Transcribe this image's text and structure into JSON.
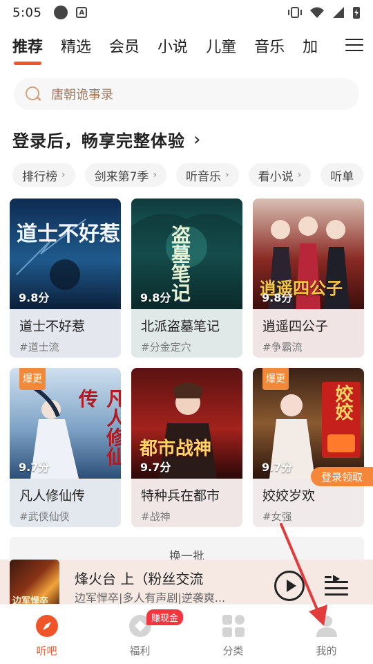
{
  "status_bar": {
    "time": "5:05",
    "notif_letter": "A"
  },
  "tabs": [
    {
      "label": "推荐"
    },
    {
      "label": "精选"
    },
    {
      "label": "会员"
    },
    {
      "label": "小说"
    },
    {
      "label": "儿童"
    },
    {
      "label": "音乐"
    },
    {
      "label": "加"
    }
  ],
  "search": {
    "placeholder": "唐朝诡事录"
  },
  "login_prompt": {
    "text": "登录后，畅享完整体验",
    "chevron": "›"
  },
  "chips": [
    {
      "label": "排行榜"
    },
    {
      "label": "剑来第7季"
    },
    {
      "label": "听音乐"
    },
    {
      "label": "看小说"
    },
    {
      "label": "听单"
    }
  ],
  "books": [
    {
      "title": "道士不好惹",
      "tag": "#道士流",
      "score": "9.8分",
      "cover_text": "道士不好惹",
      "hot": ""
    },
    {
      "title": "北派盗墓笔记",
      "tag": "#分金定穴",
      "score": "9.8分",
      "cover_text": "盗墓笔记",
      "hot": ""
    },
    {
      "title": "逍遥四公子",
      "tag": "#争霸流",
      "score": "9.8分",
      "cover_text": "逍遥四公子",
      "hot": ""
    },
    {
      "title": "凡人修仙传",
      "tag": "#武侠仙侠",
      "score": "9.7分",
      "cover_text": "凡人修仙传",
      "hot": "爆更"
    },
    {
      "title": "特种兵在都市",
      "tag": "#战神",
      "score": "9.7分",
      "cover_text": "都市战神",
      "hot": ""
    },
    {
      "title": "姣姣岁欢",
      "tag": "#女强",
      "score": "9.7分",
      "cover_text": "姣姣",
      "hot": "爆更"
    }
  ],
  "promo": {
    "label": "登录领取"
  },
  "refresh": {
    "label": "换一批"
  },
  "player": {
    "title": "烽火台 上（粉丝交流",
    "subtitle": "边军悍卒|多人有声剧|逆袭爽...",
    "cover_text": "边军悍卒"
  },
  "nav": [
    {
      "label": "听吧",
      "active": true
    },
    {
      "label": "福利",
      "badge": "赚现金"
    },
    {
      "label": "分类"
    },
    {
      "label": "我的"
    }
  ],
  "colors": {
    "accent": "#f0552a",
    "badge_red": "#f2363f",
    "promo_orange": "#f5873a",
    "annotation_red": "#e23b3b"
  }
}
